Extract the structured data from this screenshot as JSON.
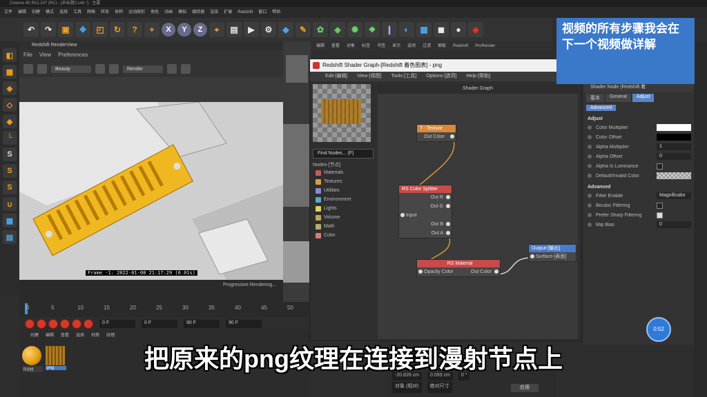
{
  "app": {
    "title": "Cinema 4D R21.207 (RC) - [未标题2.c4d *] - 主要",
    "menu": [
      "文件",
      "编辑",
      "创建",
      "模式",
      "选择",
      "工具",
      "网格",
      "样条",
      "体积",
      "运动图形",
      "角色",
      "动画",
      "模拟",
      "跟踪器",
      "渲染",
      "扩展",
      "Redshift",
      "窗口",
      "帮助"
    ]
  },
  "render_view": {
    "title": "Redshift RenderView",
    "menu": [
      "File",
      "View",
      "Preferences"
    ],
    "dropdown": "Beauty",
    "render_btn": "Render",
    "frame_info": "Frame -1: 2022-01-08 21:17:29 (0.01s)",
    "status": "Progressive Rendering..."
  },
  "object_menu": [
    "文件",
    "编辑",
    "查看",
    "对象",
    "标签",
    "书签",
    "显示",
    "选项",
    "过滤",
    "面板",
    "Redshift",
    "ProRender"
  ],
  "shader_graph": {
    "title": "Redshift Shader Graph-[Redshift 着色图表] - png",
    "menu": [
      "Edit-[编辑]",
      "View-[视图]",
      "Tools-[工具]",
      "Options-[选项]",
      "Help-[帮助]"
    ],
    "canvas_title": "Shader Graph",
    "find_placeholder": "Find Nodes... (F)",
    "nodes_header": "Nodes-[节点]",
    "categories": [
      {
        "name": "Materials",
        "color": "#c85a5a"
      },
      {
        "name": "Textures",
        "color": "#d8a040"
      },
      {
        "name": "Utilities",
        "color": "#8a8ad8"
      },
      {
        "name": "Environment",
        "color": "#5aa8c8"
      },
      {
        "name": "Lights",
        "color": "#e0d060"
      },
      {
        "name": "Volume",
        "color": "#c8a060"
      },
      {
        "name": "Math",
        "color": "#b0b070"
      },
      {
        "name": "Color",
        "color": "#d87a7a"
      }
    ],
    "nodes": {
      "texture": {
        "title": "T : Texture",
        "port": "Out Color"
      },
      "splitter": {
        "title": "RS Color Splitter",
        "input": "Input",
        "outs": [
          "Out R",
          "Out G",
          "Out B",
          "Out A"
        ]
      },
      "material": {
        "title": "RS Material",
        "in": "Opacity Color",
        "out": "Out Color"
      },
      "output": {
        "title": "Output-[输出]",
        "in": "Surface-[表面]"
      }
    }
  },
  "attributes": {
    "header": "Shader Node (Redshift 着",
    "tabs": [
      "基本",
      "General",
      "Adjust",
      "Advanced"
    ],
    "active_tab": "Adjust",
    "sections": {
      "adjust": "Adjust",
      "advanced": "Advanced"
    },
    "adjust_props": [
      {
        "label": "Color Multiplier",
        "kind": "white"
      },
      {
        "label": "Color Offset",
        "kind": "black"
      },
      {
        "label": "Alpha Multiplier",
        "value": "1"
      },
      {
        "label": "Alpha Offset",
        "value": "0"
      },
      {
        "label": "Alpha Is Luminance",
        "kind": "cb"
      },
      {
        "label": "Default/Invalid Color",
        "kind": "checker"
      }
    ],
    "advanced_props": [
      {
        "label": "Filter Enable",
        "value": "Magnificatio"
      },
      {
        "label": "Bicubic Filtering",
        "kind": "cb"
      },
      {
        "label": "Prefer Sharp Filtering",
        "kind": "cb-on"
      },
      {
        "label": "Mip Bias",
        "value": "0"
      }
    ]
  },
  "annotation": "视频的所有步骤我会在下一个视频做详解",
  "timeline": {
    "ticks": [
      "0",
      "5",
      "10",
      "15",
      "20",
      "25",
      "30",
      "35",
      "40",
      "45",
      "50"
    ],
    "fields": [
      "0 F",
      "0 F",
      "90 F",
      "90 F"
    ]
  },
  "materials": {
    "menu": [
      "创建",
      "编辑",
      "查看",
      "选择",
      "材质",
      "纹理"
    ],
    "items": [
      "RS材",
      "png"
    ]
  },
  "coords": {
    "x": "-20.826 cm",
    "y": "0.093 cm",
    "b": "0 °",
    "mode": "对象 (相对)",
    "size": "绝对尺寸",
    "apply": "应用"
  },
  "subtitle": "把原来的png纹理在连接到漫射节点上",
  "badge": "0:52"
}
